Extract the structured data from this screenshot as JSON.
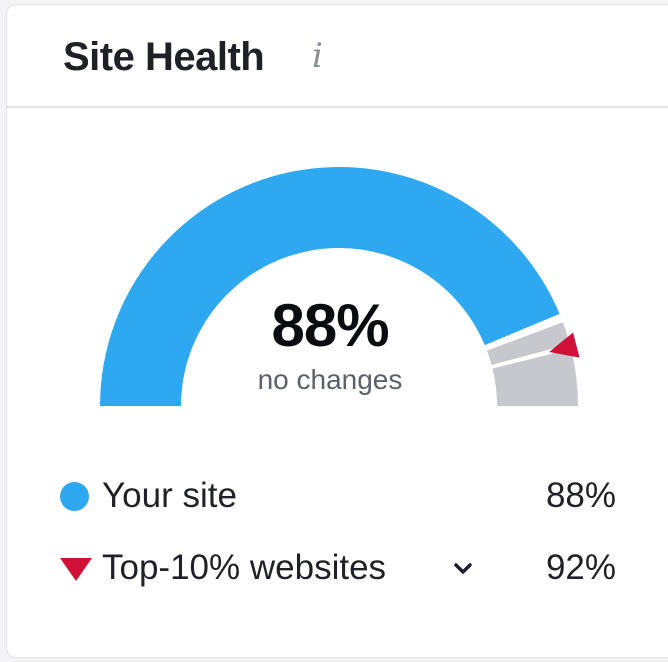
{
  "widget": {
    "title": "Site Health",
    "info_icon": "info-icon"
  },
  "gauge": {
    "value_label": "88%",
    "subtitle": "no changes",
    "your_site_percent": 88,
    "top10_percent": 92,
    "colors": {
      "your_site": "#2fa8f2",
      "remaining": "#c6c8cd",
      "top10_marker": "#d1103a"
    }
  },
  "legend": {
    "your_site": {
      "label": "Your site",
      "value": "88%",
      "marker": "blue-dot"
    },
    "top10": {
      "label": "Top-10% websites",
      "value": "92%",
      "marker": "red-triangle-down",
      "expand_icon": "chevron-down-icon"
    }
  }
}
